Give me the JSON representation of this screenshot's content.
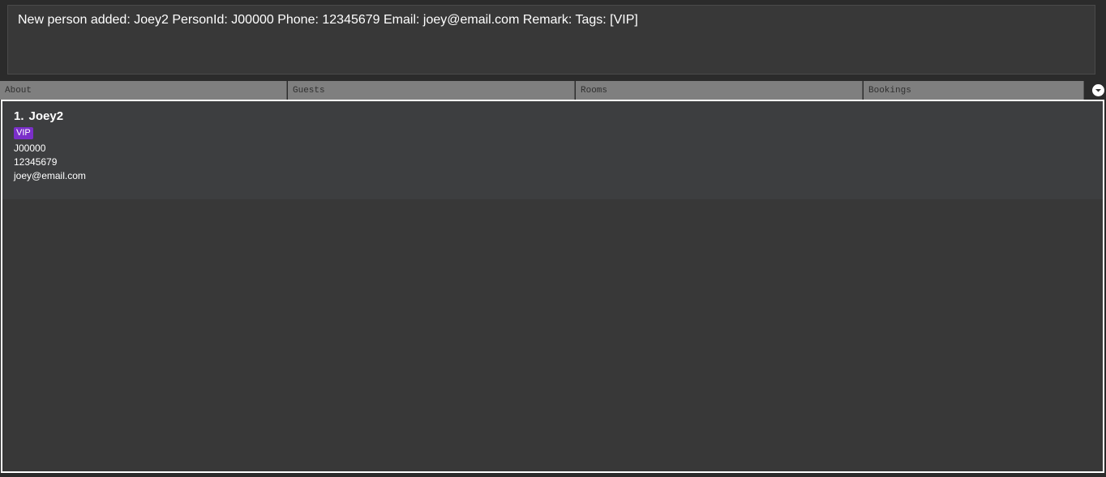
{
  "result": {
    "message": "New person added: Joey2 PersonId: J00000 Phone: 12345679 Email: joey@email.com Remark:  Tags: [VIP]"
  },
  "tabs": [
    {
      "label": "About"
    },
    {
      "label": "Guests"
    },
    {
      "label": "Rooms"
    },
    {
      "label": "Bookings"
    }
  ],
  "tab_menu_icon": "chevron-down-icon",
  "persons": [
    {
      "index": "1.",
      "name": "Joey2",
      "tags": [
        "VIP"
      ],
      "person_id": "J00000",
      "phone": "12345679",
      "email": "joey@email.com"
    }
  ],
  "colors": {
    "tag_background": "#7b2fc9",
    "tab_background": "#7f7f7f",
    "panel_background": "#383838",
    "card_background": "#3d3e40"
  }
}
